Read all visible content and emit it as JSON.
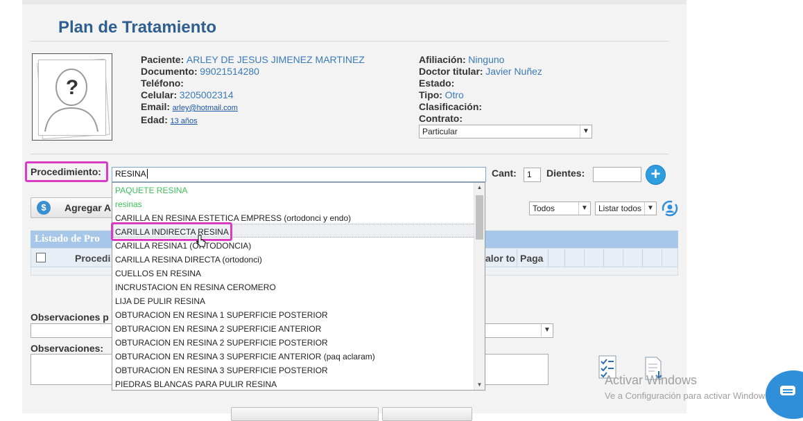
{
  "page_title": "Plan de Tratamiento",
  "patient": {
    "labels": {
      "paciente": "Paciente:",
      "documento": "Documento:",
      "telefono": "Teléfono:",
      "celular": "Celular:",
      "email": "Email:",
      "edad": "Edad:",
      "afiliacion": "Afiliación:",
      "doctor": "Doctor titular:",
      "estado": "Estado:",
      "tipo": "Tipo:",
      "clasificacion": "Clasificación:",
      "contrato": "Contrato:"
    },
    "paciente": "ARLEY DE JESUS JIMENEZ MARTINEZ",
    "documento": "99021514280",
    "celular": "3205002314",
    "email": "arley@hotmail.com",
    "edad": "13 años",
    "afiliacion": "Ninguno",
    "doctor": "Javier Nuñez",
    "tipo": "Otro",
    "contrato": "Particular",
    "photo_placeholder": "?"
  },
  "procedure": {
    "label": "Procedimiento:",
    "value": "RESINA",
    "cant_label": "Cant:",
    "cant_value": "1",
    "dientes_label": "Dientes:",
    "add_icon": "plus-circle-icon"
  },
  "dropdown_options": [
    {
      "label": "PAQUETE RESINA",
      "green": true
    },
    {
      "label": "resinas",
      "green": true
    },
    {
      "label": "CARILLA EN RESINA ESTETICA EMPRESS (ortodonci y endo)",
      "green": false
    },
    {
      "label": "CARILLA INDIRECTA RESINA",
      "green": false
    },
    {
      "label": "CARILLA RESINA1 (ORTODONCIA)",
      "green": false
    },
    {
      "label": "CARILLA RESINA DIRECTA (ortodonci)",
      "green": false
    },
    {
      "label": "CUELLOS EN RESINA",
      "green": false
    },
    {
      "label": "INCRUSTACION EN RESINA CEROMERO",
      "green": false
    },
    {
      "label": "LIJA DE PULIR RESINA",
      "green": false
    },
    {
      "label": "OBTURACION EN RESINA 1 SUPERFICIE POSTERIOR",
      "green": false
    },
    {
      "label": "OBTURACION EN RESINA 2 SUPERFICIE ANTERIOR",
      "green": false
    },
    {
      "label": "OBTURACION EN RESINA 2 SUPERFICIE POSTERIOR",
      "green": false
    },
    {
      "label": "OBTURACION EN RESINA 3 SUPERFICIE ANTERIOR (paq aclaram)",
      "green": false
    },
    {
      "label": "OBTURACION EN RESINA 3 SUPERFICIE POSTERIOR",
      "green": false
    },
    {
      "label": "PIEDRAS BLANCAS PARA PULIR RESINA",
      "green": false
    }
  ],
  "toolbar": {
    "agregar_label": "Agregar A",
    "filter_value": "Todos",
    "list_value": "Listar todos"
  },
  "table": {
    "title": "Listado de Pro",
    "col_procedimiento": "Procedi",
    "col_valor": "alor to",
    "col_paga": "Paga"
  },
  "observaciones_p_label": "Observaciones p",
  "observaciones_label": "Observaciones:",
  "watermark": {
    "line1": "Activar Windows",
    "line2": "Ve a Configuración para activar Windows."
  },
  "colors": {
    "title": "#2f5f8f",
    "value": "#3a7ab8",
    "highlight": "#d93bc4",
    "green_option": "#3cbf5a"
  }
}
